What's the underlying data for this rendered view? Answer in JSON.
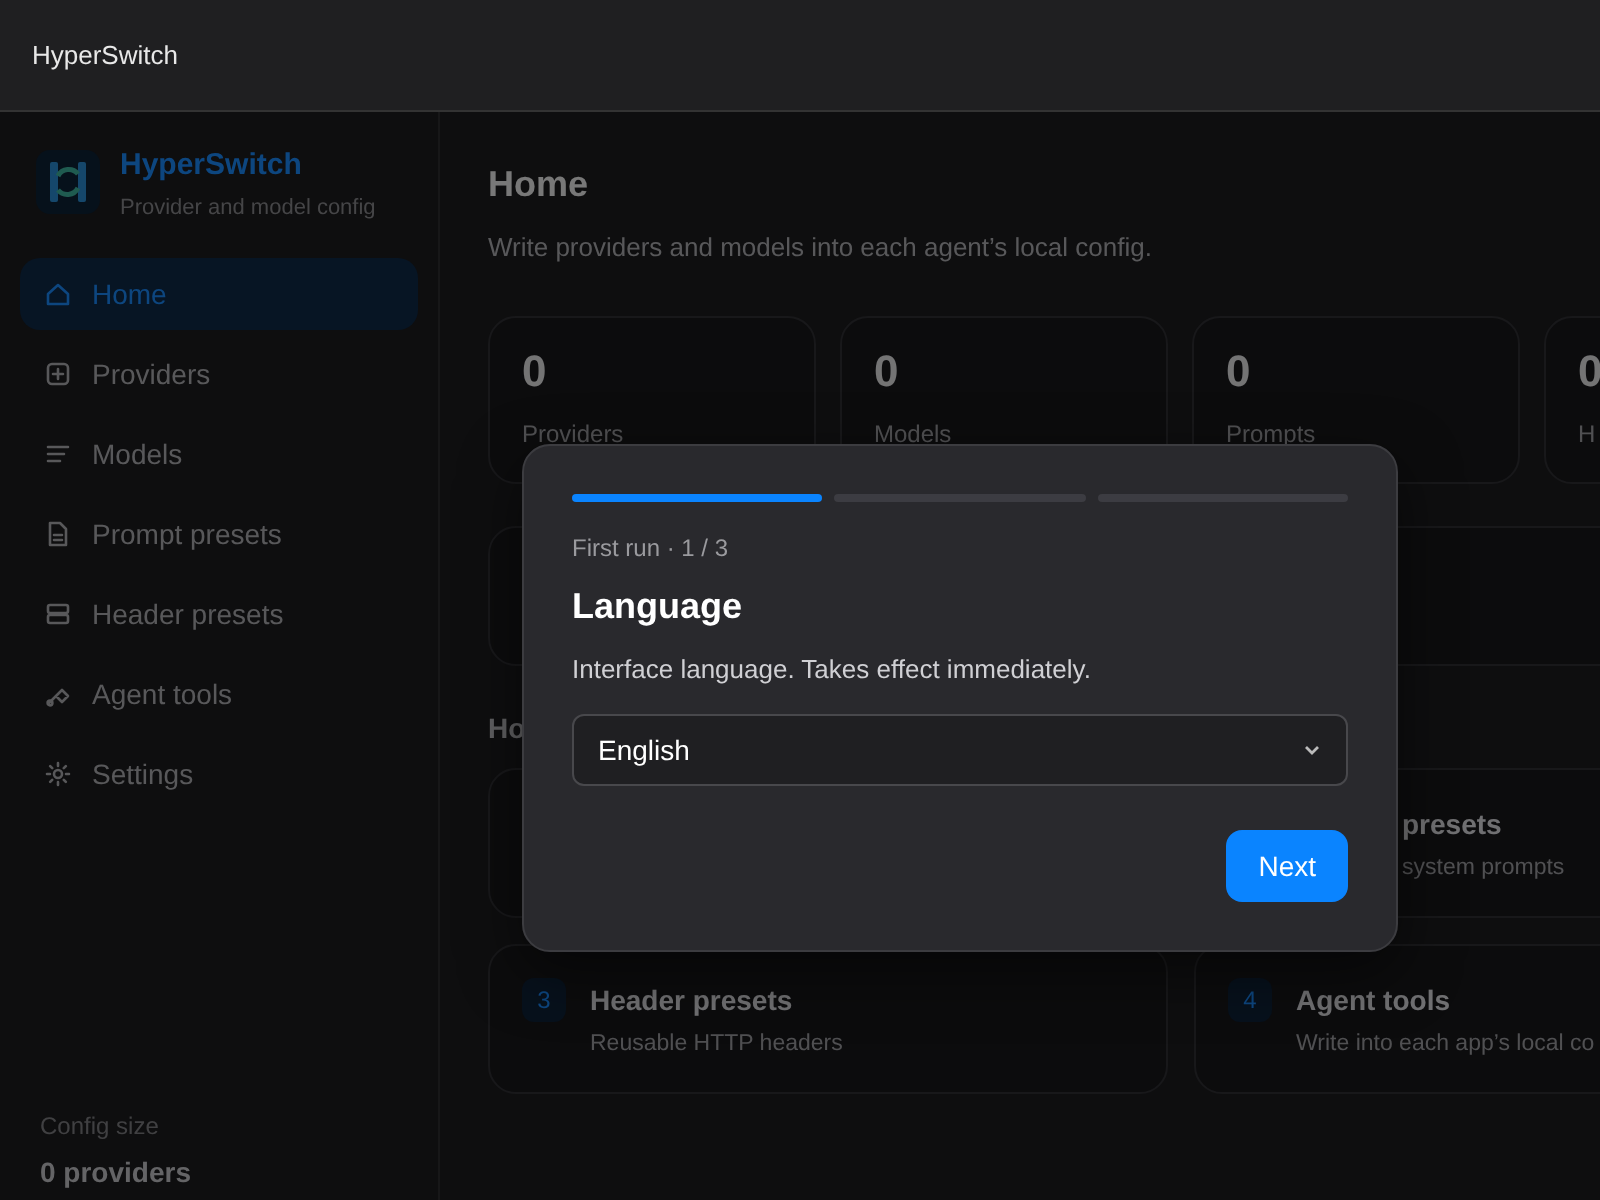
{
  "window": {
    "title": "HyperSwitch"
  },
  "sidebar": {
    "brand": {
      "name": "HyperSwitch",
      "subtitle": "Provider and model config"
    },
    "items": [
      {
        "label": "Home",
        "selected": true
      },
      {
        "label": "Providers",
        "selected": false
      },
      {
        "label": "Models",
        "selected": false
      },
      {
        "label": "Prompt presets",
        "selected": false
      },
      {
        "label": "Header presets",
        "selected": false
      },
      {
        "label": "Agent tools",
        "selected": false
      },
      {
        "label": "Settings",
        "selected": false
      }
    ],
    "footer": {
      "label": "Config size",
      "value": "0 providers"
    }
  },
  "page": {
    "title": "Home",
    "subtitle": "Write providers and models into each agent’s local config.",
    "stats": [
      {
        "value": "0",
        "label": "Providers"
      },
      {
        "value": "0",
        "label": "Models"
      },
      {
        "value": "0",
        "label": "Prompts"
      },
      {
        "value": "0",
        "label": "H"
      }
    ],
    "section_heading": "Ho",
    "guide_cards": [
      {
        "kind": "covered"
      },
      {
        "kind": "partial",
        "title": "presets",
        "description": "system prompts"
      },
      {
        "kind": "full",
        "number": "3",
        "title": "Header presets",
        "description": "Reusable HTTP headers"
      },
      {
        "kind": "full",
        "number": "4",
        "title": "Agent tools",
        "description": "Write into each app’s local co"
      }
    ]
  },
  "dialog": {
    "steps": [
      {
        "active": true
      },
      {
        "active": false
      },
      {
        "active": false
      }
    ],
    "eyebrow": "First run · 1 / 3",
    "title": "Language",
    "description": "Interface language. Takes effect immediately.",
    "select": {
      "value": "English"
    },
    "primary_button": "Next"
  }
}
